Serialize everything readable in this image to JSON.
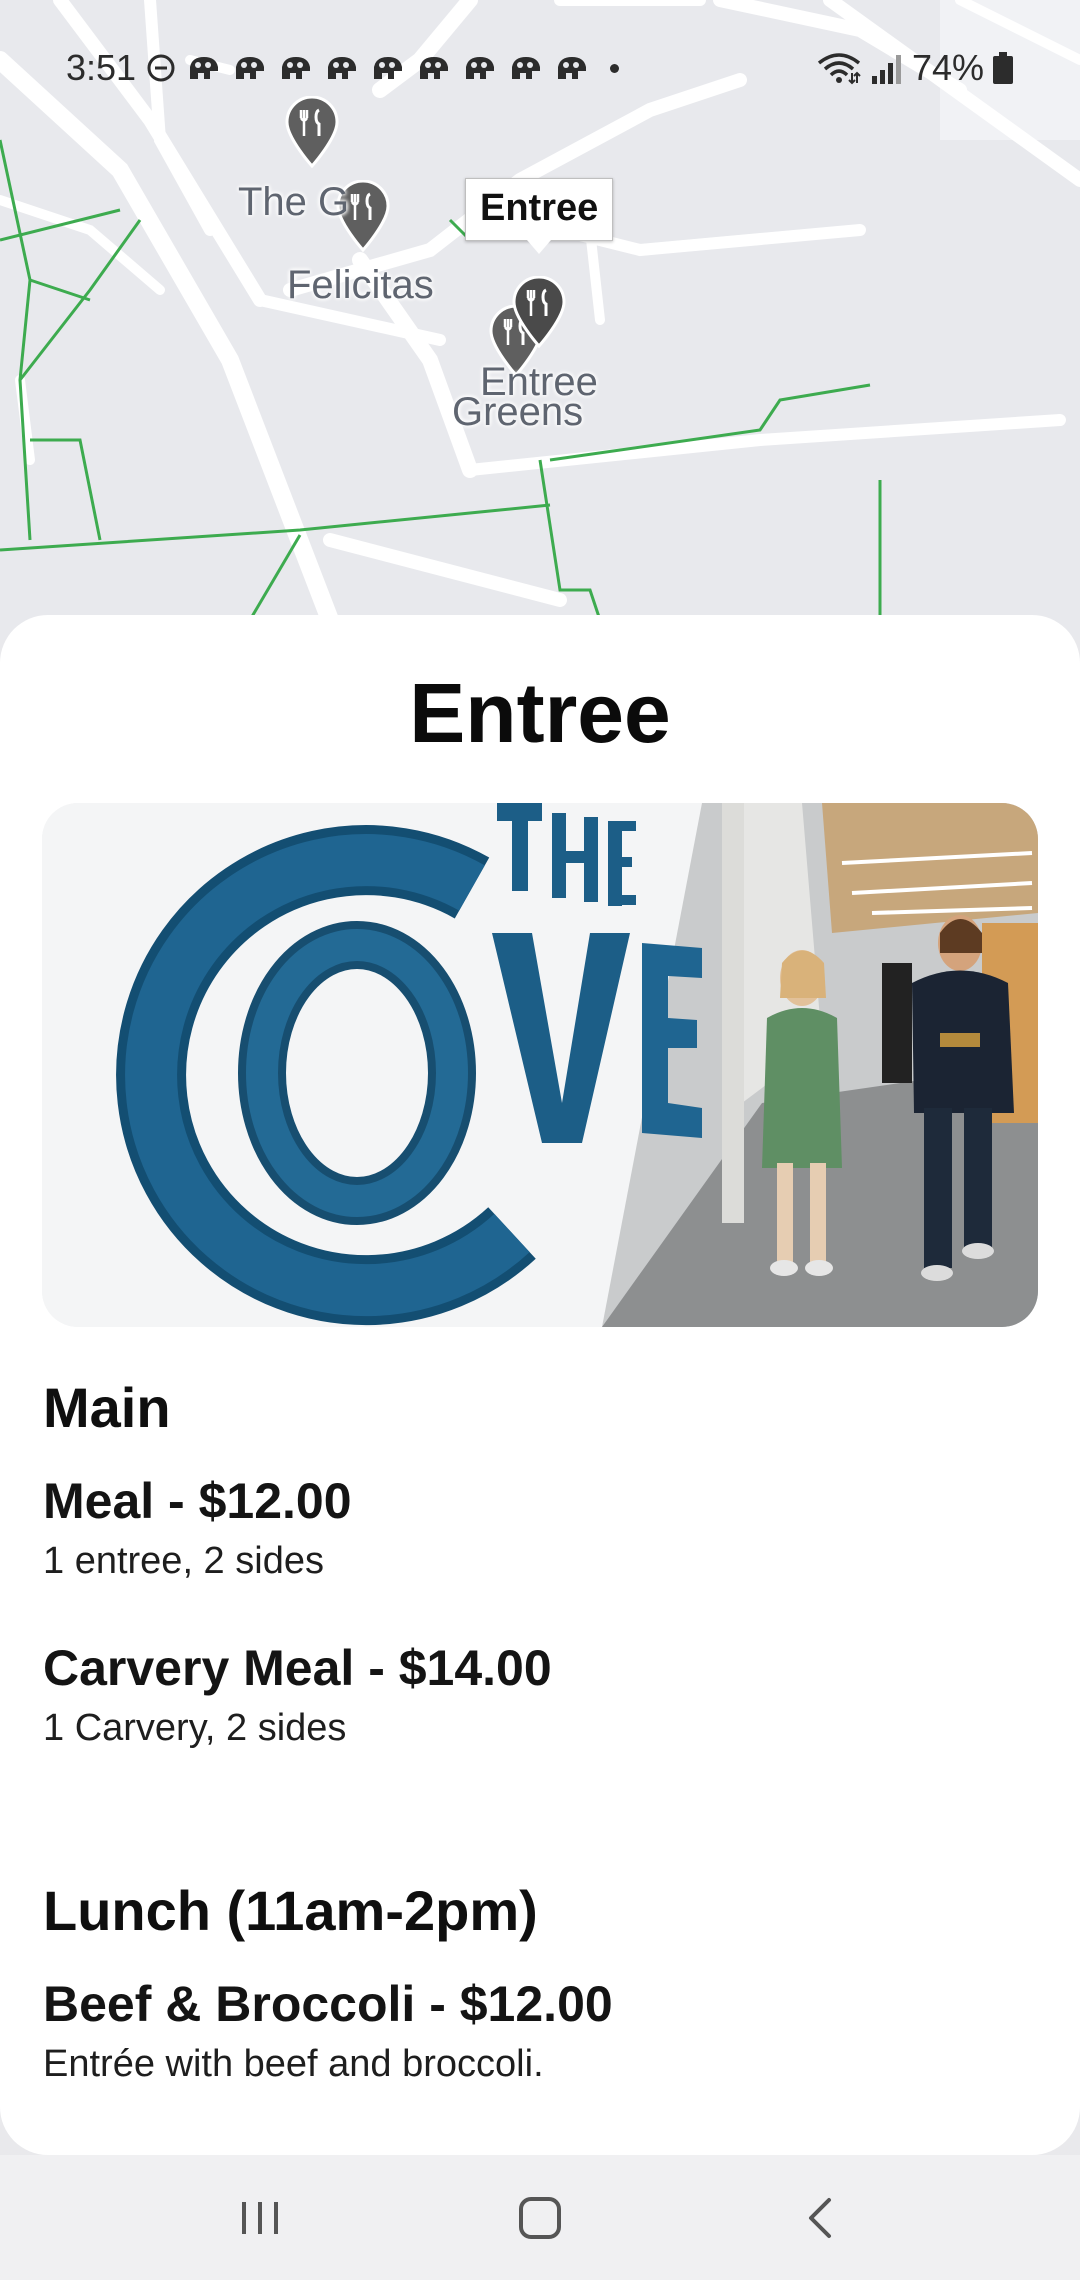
{
  "status_bar": {
    "time": "3:51",
    "battery": "74%"
  },
  "map": {
    "labels": {
      "the_grill": "The G",
      "felicitas": "Felicitas",
      "entree": "Entree",
      "greens": "Greens"
    },
    "selected_callout": "Entree",
    "road_color": "#ffffff",
    "path_color": "#3dab4f",
    "background_color": "#e8e9ed",
    "pin_icon": "restaurant-marker-icon"
  },
  "sheet": {
    "title": "Entree",
    "image_alt": "The Cove dining hall sign with students walking",
    "sections": [
      {
        "heading": "Main",
        "items": [
          {
            "name": "Meal - $12.00",
            "description": "1 entree, 2 sides"
          },
          {
            "name": "Carvery Meal - $14.00",
            "description": "1 Carvery, 2 sides"
          }
        ]
      },
      {
        "heading": "Lunch (11am-2pm)",
        "items": [
          {
            "name": "Beef & Broccoli - $12.00",
            "description": "Entrée with beef and broccoli."
          }
        ]
      }
    ]
  },
  "nav_bar": {
    "recents_icon": "recents-icon",
    "home_icon": "home-icon",
    "back_icon": "back-icon"
  }
}
